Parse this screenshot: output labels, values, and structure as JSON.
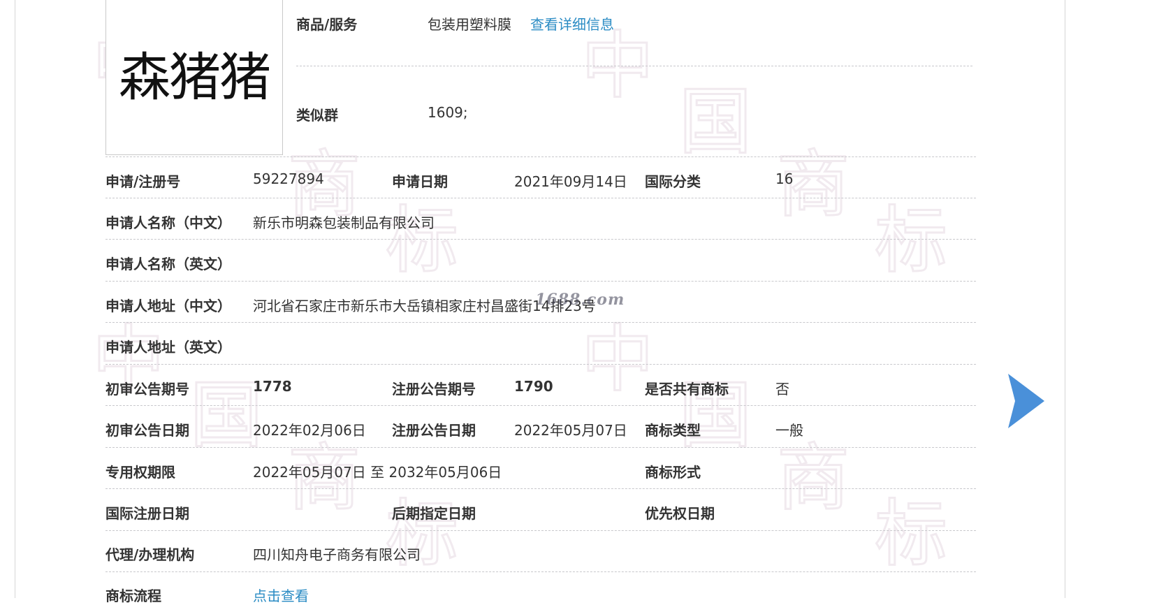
{
  "trademark": {
    "name_image_text": "森猪猪",
    "goods_services_label": "商品/服务",
    "goods_services_value": "包装用塑料膜",
    "details_link": "查看详细信息",
    "similar_group_label": "类似群",
    "similar_group_value": "1609;"
  },
  "fields": {
    "reg_no_label": "申请/注册号",
    "reg_no": "59227894",
    "app_date_label": "申请日期",
    "app_date": "2021年09月14日",
    "intl_class_label": "国际分类",
    "intl_class": "16",
    "applicant_cn_label": "申请人名称（中文）",
    "applicant_cn": "新乐市明森包装制品有限公司",
    "applicant_en_label": "申请人名称（英文）",
    "address_cn_label": "申请人地址（中文）",
    "address_cn": "河北省石家庄市新乐市大岳镇相家庄村昌盛街14排23号",
    "address_en_label": "申请人地址（英文）",
    "prelim_issue_label": "初审公告期号",
    "prelim_issue": "1778",
    "reg_issue_label": "注册公告期号",
    "reg_issue": "1790",
    "shared_label": "是否共有商标",
    "shared": "否",
    "prelim_date_label": "初审公告日期",
    "prelim_date": "2022年02月06日",
    "reg_date_label": "注册公告日期",
    "reg_date": "2022年05月07日",
    "tm_type_label": "商标类型",
    "tm_type": "一般",
    "validity_label": "专用权期限",
    "validity": "2022年05月07日 至 2032年05月06日",
    "tm_form_label": "商标形式",
    "intl_reg_date_label": "国际注册日期",
    "later_designation_label": "后期指定日期",
    "priority_date_label": "优先权日期",
    "agent_label": "代理/办理机构",
    "agent": "四川知舟电子商务有限公司",
    "process_label": "商标流程",
    "process_link": "点击查看"
  },
  "watermark": {
    "chars": [
      "中",
      "国",
      "商",
      "标"
    ],
    "site_text": "1688.com"
  },
  "colors": {
    "link": "#2b8cc4",
    "arrow": "#4a90d9",
    "divider": "#c8c8cc",
    "watermark": "#f0e8ee"
  },
  "icons": {
    "next": "next-arrow-icon"
  }
}
